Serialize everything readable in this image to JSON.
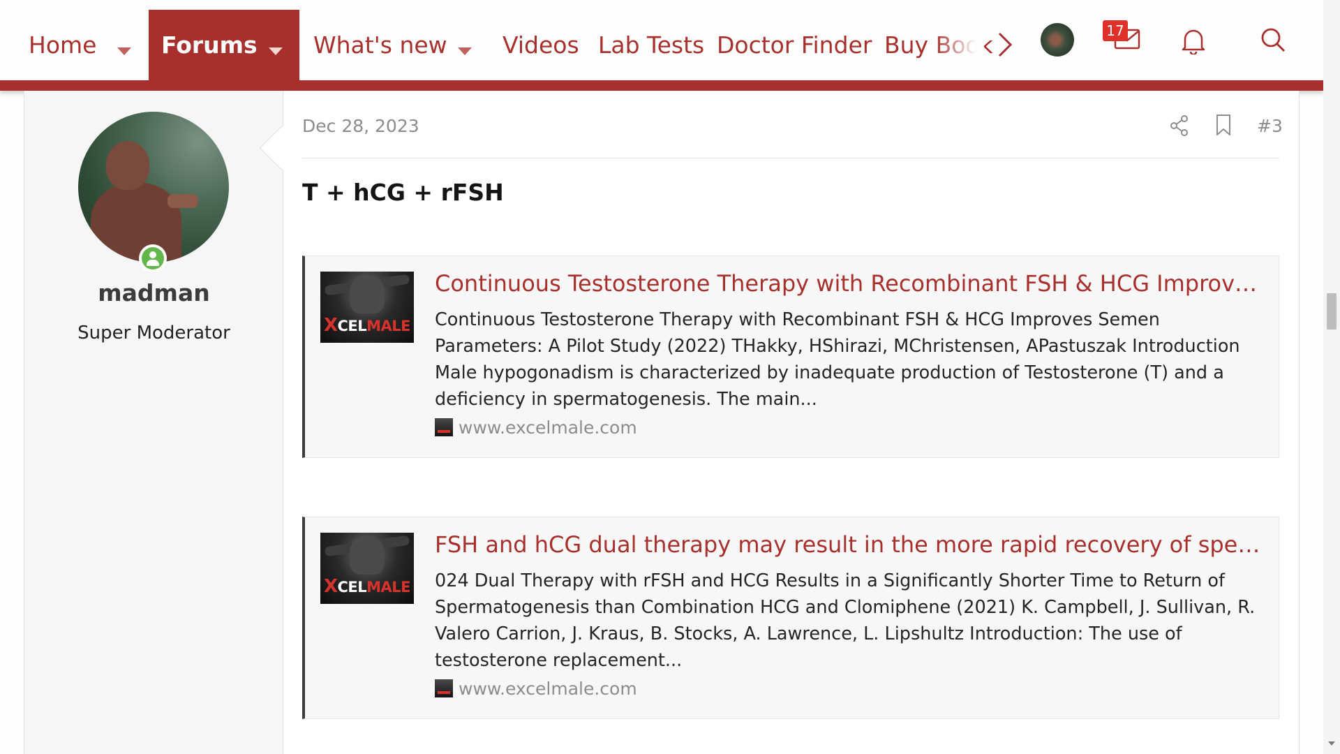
{
  "nav": {
    "items": [
      {
        "label": "Home"
      },
      {
        "label": "Forums"
      },
      {
        "label": "What's new"
      },
      {
        "label": "Videos"
      },
      {
        "label": "Lab Tests"
      },
      {
        "label": "Doctor Finder"
      },
      {
        "label": "Buy Book"
      }
    ],
    "active": "Forums",
    "inbox_count": "17",
    "icons": [
      "chevron-right-icon",
      "avatar",
      "envelope-icon",
      "bell-icon",
      "search-icon"
    ]
  },
  "post": {
    "user": {
      "name": "madman",
      "title": "Super Moderator",
      "online": true
    },
    "date": "Dec 28, 2023",
    "number": "#3",
    "heading": "T + hCG + rFSH",
    "embeds": [
      {
        "title": "Continuous Testosterone Therapy with Recombinant FSH & HCG Improves Se...",
        "description": "Continuous Testosterone Therapy with Recombinant FSH & HCG Improves Semen Parameters: A Pilot Study (2022) THakky, HShirazi, MChristensen, APastuszak Introduction Male hypogonadism is characterized by inadequate production of Testosterone (T) and a deficiency in spermatogenesis. The main...",
        "source": "www.excelmale.com",
        "thumb_logo": "EXCELMALE"
      },
      {
        "title": "FSH and hCG dual therapy may result in the more rapid recovery of sperm to t...",
        "description": "024 Dual Therapy with rFSH and HCG Results in a Significantly Shorter Time to Return of Spermatogenesis than Combination HCG and Clomiphene (2021) K. Campbell, J. Sullivan, R. Valero Carrion, J. Kraus, B. Stocks, A. Lawrence, L. Lipshultz Introduction: The use of testosterone replacement...",
        "source": "www.excelmale.com",
        "thumb_logo": "EXCELMALE"
      }
    ]
  },
  "colors": {
    "brand": "#a8302c",
    "badge": "#e0302a",
    "online": "#63b649"
  }
}
